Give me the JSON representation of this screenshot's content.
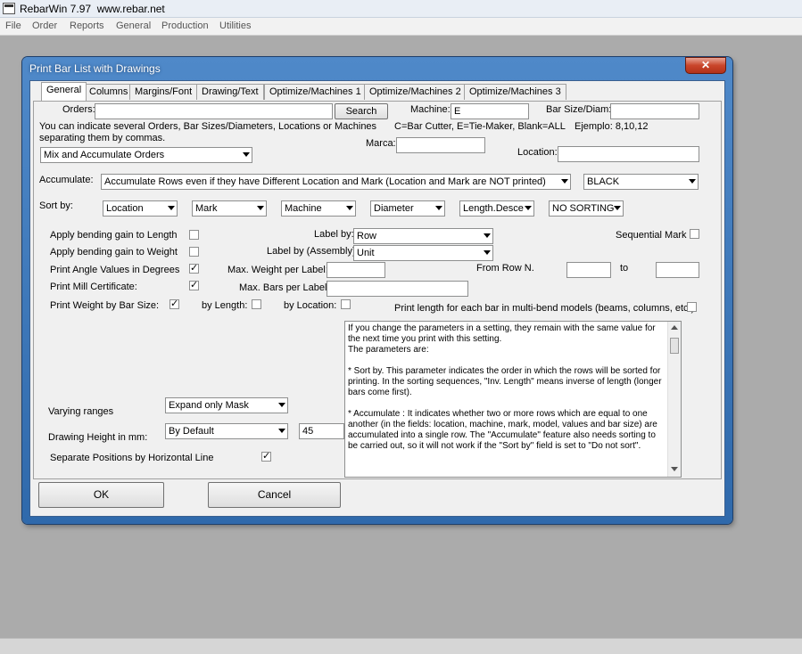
{
  "app": {
    "title": "RebarWin 7.97  www.rebar.net",
    "menu": [
      "File",
      "Order",
      "Reports",
      "General",
      "Production",
      "Utilities"
    ]
  },
  "dialog": {
    "title": "Print Bar List with Drawings",
    "close": "✕",
    "tabs": [
      "General",
      "Columns",
      "Margins/Font",
      "Drawing/Text",
      "Optimize/Machines 1",
      "Optimize/Machines 2",
      "Optimize/Machines 3"
    ],
    "active_tab": "General"
  },
  "form": {
    "orders_label": "Orders:",
    "orders_value": "",
    "search_button": "Search",
    "machine_label": "Machine:",
    "machine_value": "E",
    "bar_size_label": "Bar Size/Diam:",
    "bar_size_value": "",
    "hint_line1": "You can indicate several Orders, Bar Sizes/Diameters, Locations or Machines",
    "hint_line2": "separating them by commas.",
    "hint_machine": "C=Bar Cutter, E=Tie-Maker, Blank=ALL",
    "hint_example": "Ejemplo: 8,10,12",
    "marca_label": "Marca:",
    "marca_value": "",
    "location_label": "Location:",
    "location_value": "",
    "orders_mode": "Mix and Accumulate Orders",
    "accumulate_label": "Accumulate:",
    "accumulate_value": "Accumulate Rows even if they have Different Location and Mark (Location and Mark are NOT printed)",
    "color_value": "BLACK",
    "sort_label": "Sort by:",
    "sort_values": [
      "Location",
      "Mark",
      "Machine",
      "Diameter",
      "Length.Desce",
      "NO SORTING"
    ],
    "apply_gain_length": "Apply bending gain to Length",
    "apply_gain_weight": "Apply bending gain to Weight",
    "print_angle": "Print Angle Values in Degrees",
    "print_mill": "Print Mill Certificate:",
    "print_weight_bar": "Print Weight by Bar Size:",
    "by_length": "by Length:",
    "by_location": "by Location:",
    "check_mark": "✓",
    "label_by_label": "Label by:",
    "label_by_value": "Row",
    "label_assembly_label": "Label by (Assembly):",
    "label_assembly_value": "Unit",
    "max_weight_label": "Max. Weight per Label:",
    "max_weight_value": "",
    "max_bars_label": "Max. Bars per Label:",
    "max_bars_value": "",
    "sequential_mark": "Sequential Mark",
    "from_row_label": "From Row N.",
    "from_row_value": "",
    "to_label": "to",
    "to_value": "",
    "print_length_multibend": "Print length for each bar in multi-bend models (beams, columns, etc.):",
    "varying_ranges_label": "Varying ranges",
    "varying_ranges_value": "Expand only Mask",
    "drawing_height_label": "Drawing Height in mm:",
    "drawing_height_mode": "By Default",
    "drawing_height_value": "45",
    "separate_positions": "Separate Positions by Horizontal Line",
    "help_text": "If you change the parameters in a setting, they remain with the same value for the next time you print with this setting.\nThe parameters are:\n\n* Sort by. This parameter indicates the order in which the rows will be sorted for printing. In the sorting sequences, \"Inv. Length\" means inverse of length (longer bars come first).\n\n* Accumulate : It indicates whether two or more rows which are equal to one another (in the fields: location, machine, mark, model, values and bar size) are accumulated into a single row. The \"Accumulate\" feature also needs sorting to be carried out, so it will not work if the \"Sort by\" field is set to \"Do not sort\".",
    "ok_button": "OK",
    "cancel_button": "Cancel"
  },
  "colors": {
    "dialog_frame": "#3d78bb",
    "close_button": "#c9452a",
    "desktop": "#ababab"
  }
}
